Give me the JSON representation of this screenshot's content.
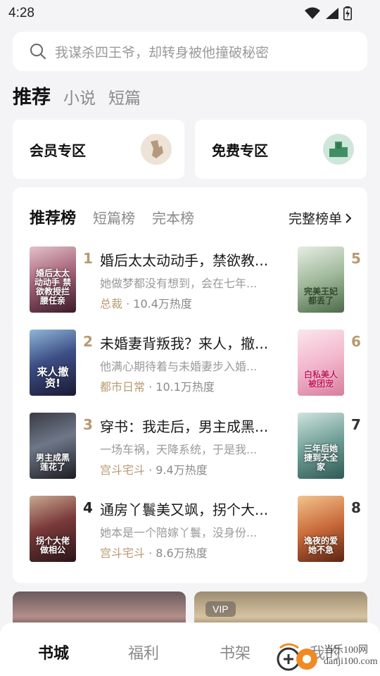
{
  "status_bar": {
    "time": "4:28"
  },
  "search": {
    "placeholder": "我谋杀四王爷，却转身被他撞破秘密"
  },
  "top_tabs": [
    "推荐",
    "小说",
    "短篇"
  ],
  "zones": [
    {
      "label": "会员专区",
      "icon": "member-icon",
      "color": "#e9dfd3"
    },
    {
      "label": "免费专区",
      "icon": "free-icon",
      "color": "#cfe6da"
    }
  ],
  "rank_tabs": [
    "推荐榜",
    "短篇榜",
    "完本榜"
  ],
  "full_list_label": "完整榜单",
  "books": [
    {
      "rank": "1",
      "title": "婚后太太动动手，禁欲教...",
      "desc": "她做梦都没有想到，会在七年...",
      "tag": "总裁",
      "heat": "10.4万热度",
      "cover_text": "婚后太太动动手 禁欲教授拦腰任亲"
    },
    {
      "rank": "2",
      "title": "未婚妻背叛我？来人，撤...",
      "desc": "他满心期待着与未婚妻步入婚...",
      "tag": "都市日常",
      "heat": "10.1万热度",
      "cover_text": "来人撤资!"
    },
    {
      "rank": "3",
      "title": "穿书：我走后，男主成黑...",
      "desc": "一场车祸，天降系统，于是我...",
      "tag": "宫斗宅斗",
      "heat": "9.4万热度",
      "cover_text": "男主成黑莲花了"
    },
    {
      "rank": "4",
      "title": "通房丫鬟美又飒，拐个大...",
      "desc": "她本是一个陪嫁丫鬟，没身份...",
      "tag": "宫斗宅斗",
      "heat": "8.6万热度",
      "cover_text": "拐个大佬做相公"
    }
  ],
  "side_books": [
    {
      "rank": "5",
      "cover_text": "完美王妃都丢了"
    },
    {
      "rank": "6",
      "cover_text": "白私美人被团宠"
    },
    {
      "rank": "7",
      "cover_text": "三年后她捷到天全家"
    },
    {
      "rank": "8",
      "cover_text": "逸夜的爱她不急"
    }
  ],
  "vip_label": "VIP",
  "bottom_nav": [
    "书城",
    "福利",
    "书架",
    "我的"
  ],
  "watermark": {
    "line1": "当乐100网",
    "line2": "danji100.com"
  }
}
